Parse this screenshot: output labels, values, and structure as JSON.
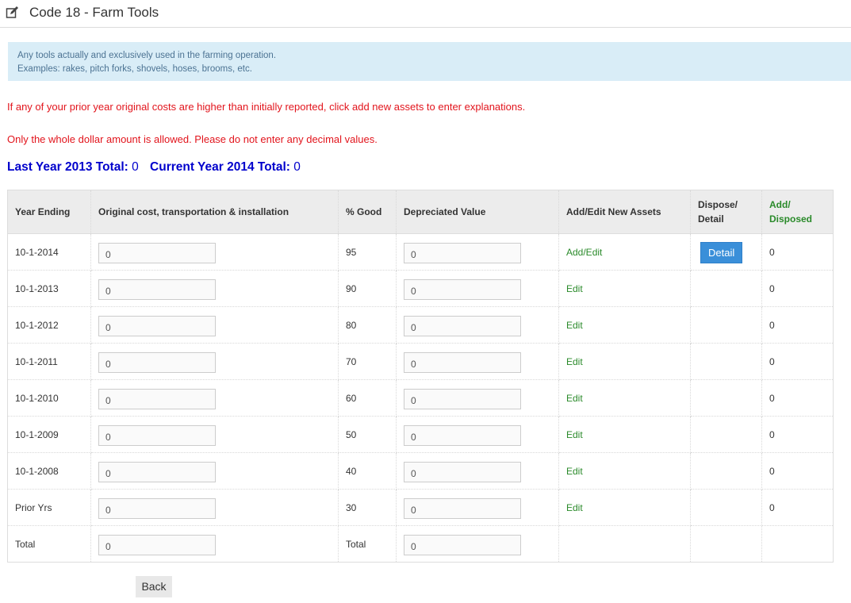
{
  "header": {
    "title": "Code 18 - Farm Tools",
    "icon": "edit-icon"
  },
  "info": {
    "line1": "Any tools actually and exclusively used in the farming operation.",
    "line2": "Examples: rakes, pitch forks, shovels, hoses, brooms, etc."
  },
  "warnings": {
    "line1": "If any of your prior year original costs are higher than initially reported, click add new assets to enter explanations.",
    "line2": "Only the whole dollar amount is allowed. Please do not enter any decimal values."
  },
  "totals": {
    "last_label": "Last Year 2013 Total:",
    "last_value": "0",
    "current_label": "Current Year 2014 Total:",
    "current_value": "0"
  },
  "table": {
    "headers": {
      "year": "Year Ending",
      "cost": "Original cost, transportation & installation",
      "good": "% Good",
      "depr": "Depreciated Value",
      "addedit": "Add/Edit New Assets",
      "dispose_1": "Dispose/",
      "dispose_2": "Detail",
      "added_1": "Add/",
      "added_2": "Disposed"
    },
    "rows": [
      {
        "year": "10-1-2014",
        "cost": "0",
        "good": "95",
        "depr": "0",
        "action": "Add/Edit",
        "detail": "Detail",
        "count": "0"
      },
      {
        "year": "10-1-2013",
        "cost": "0",
        "good": "90",
        "depr": "0",
        "action": "Edit",
        "count": "0"
      },
      {
        "year": "10-1-2012",
        "cost": "0",
        "good": "80",
        "depr": "0",
        "action": "Edit",
        "count": "0"
      },
      {
        "year": "10-1-2011",
        "cost": "0",
        "good": "70",
        "depr": "0",
        "action": "Edit",
        "count": "0"
      },
      {
        "year": "10-1-2010",
        "cost": "0",
        "good": "60",
        "depr": "0",
        "action": "Edit",
        "count": "0"
      },
      {
        "year": "10-1-2009",
        "cost": "0",
        "good": "50",
        "depr": "0",
        "action": "Edit",
        "count": "0"
      },
      {
        "year": "10-1-2008",
        "cost": "0",
        "good": "40",
        "depr": "0",
        "action": "Edit",
        "count": "0"
      },
      {
        "year": "Prior Yrs",
        "cost": "0",
        "good": "30",
        "depr": "0",
        "action": "Edit",
        "count": "0"
      }
    ],
    "total_row": {
      "label": "Total",
      "cost": "0",
      "good_label": "Total",
      "depr": "0"
    }
  },
  "back_label": "Back"
}
